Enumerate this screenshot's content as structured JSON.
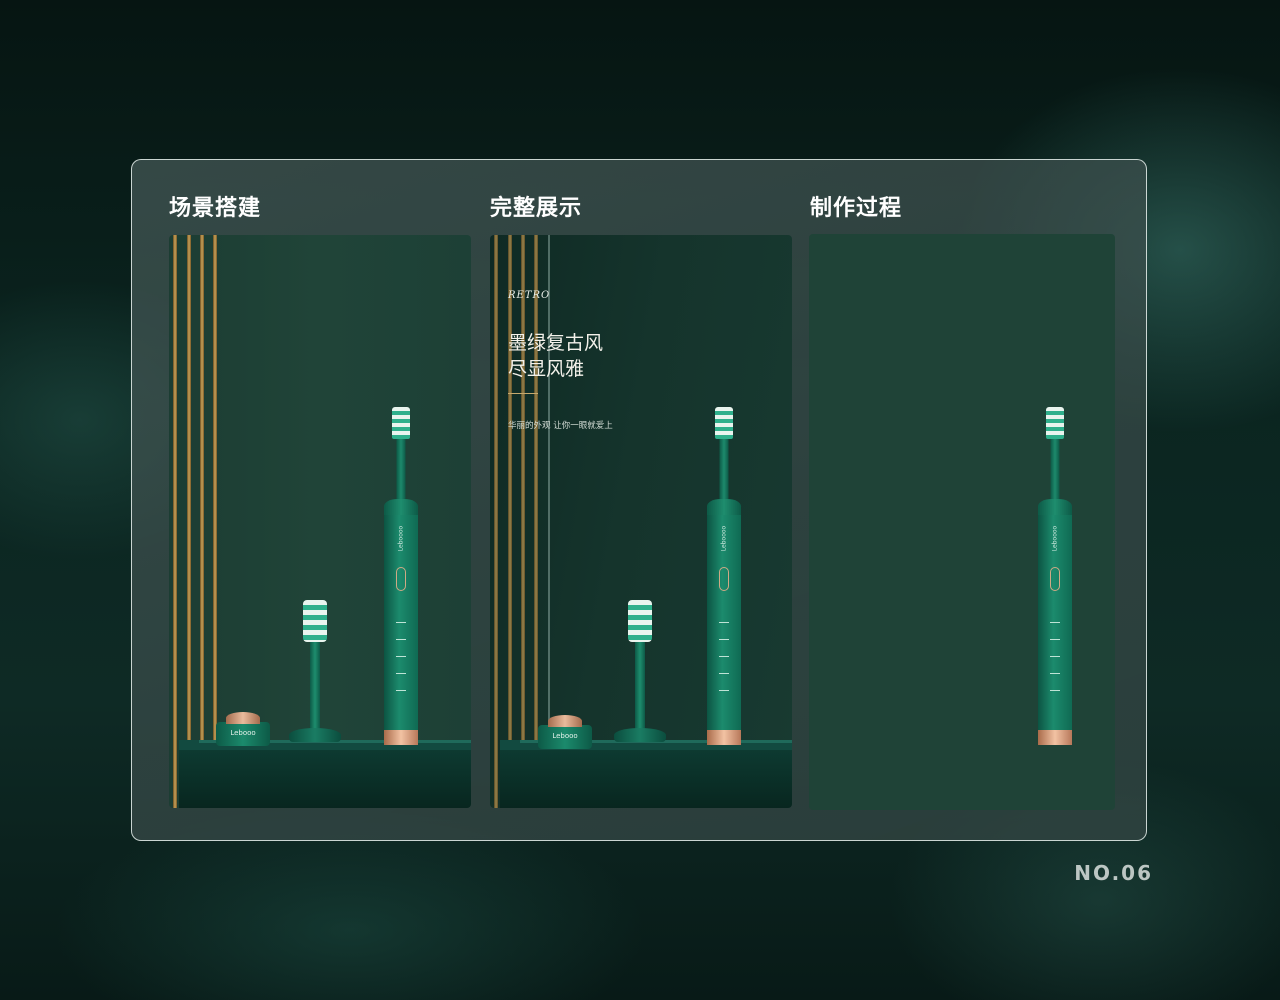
{
  "columns": [
    {
      "title": "场景搭建"
    },
    {
      "title": "完整展示"
    },
    {
      "title": "制作过程"
    }
  ],
  "poster": {
    "eyebrow": "RETRO",
    "headline_line1": "墨绿复古风",
    "headline_line2": "尽显风雅",
    "tagline": "华丽的外观 让你一眼就爱上"
  },
  "product": {
    "brand": "Leboooo",
    "charger_logo": "Lebooo"
  },
  "page_number": "NO.06",
  "colors": {
    "frame_border": "#e6f0ec",
    "panel_green": "#1f4337",
    "gold": "#c9a25a",
    "rose_gold": "#f2c2a3"
  }
}
